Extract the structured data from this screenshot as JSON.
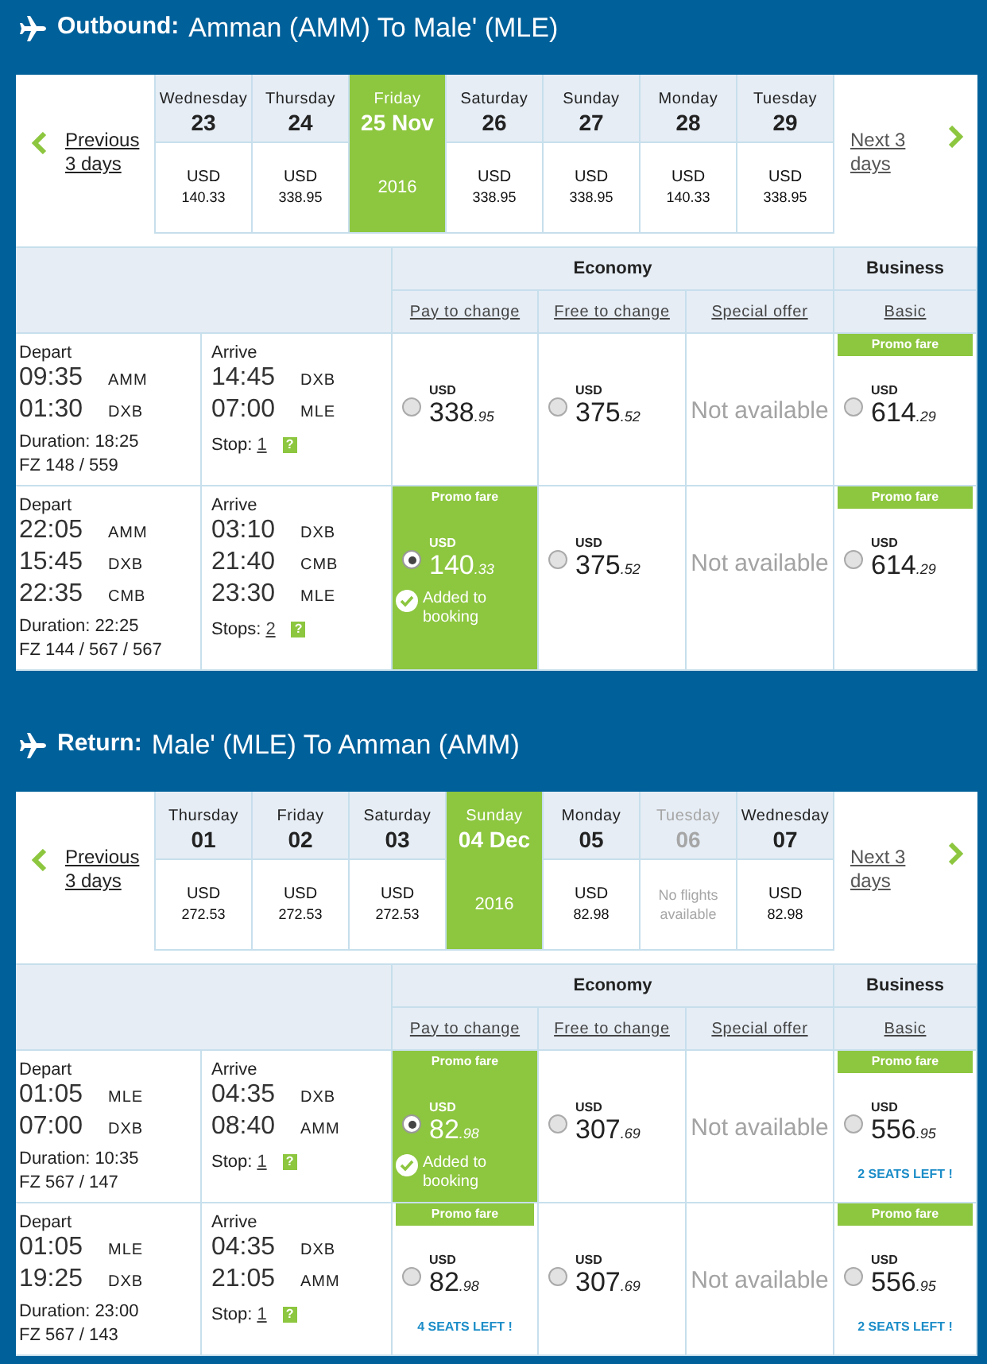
{
  "sections": [
    {
      "direction": "Outbound:",
      "route": "Amman (AMM) To Male' (MLE)",
      "previous": [
        "Previous",
        "3 days"
      ],
      "next": [
        "Next 3",
        "days"
      ],
      "dates": [
        {
          "weekday": "Wednesday",
          "day": "23",
          "selected": false,
          "disabled": false,
          "currency": "USD",
          "price": "140.33"
        },
        {
          "weekday": "Thursday",
          "day": "24",
          "selected": false,
          "disabled": false,
          "currency": "USD",
          "price": "338.95"
        },
        {
          "weekday": "Friday",
          "day": "25 Nov",
          "selected": true,
          "disabled": false,
          "year": "2016"
        },
        {
          "weekday": "Saturday",
          "day": "26",
          "selected": false,
          "disabled": false,
          "currency": "USD",
          "price": "338.95"
        },
        {
          "weekday": "Sunday",
          "day": "27",
          "selected": false,
          "disabled": false,
          "currency": "USD",
          "price": "338.95"
        },
        {
          "weekday": "Monday",
          "day": "28",
          "selected": false,
          "disabled": false,
          "currency": "USD",
          "price": "140.33"
        },
        {
          "weekday": "Tuesday",
          "day": "29",
          "selected": false,
          "disabled": false,
          "currency": "USD",
          "price": "338.95"
        }
      ],
      "cabins": [
        {
          "name": "Economy",
          "fares": [
            "Pay to change",
            "Free to change",
            "Special offer"
          ]
        },
        {
          "name": "Business",
          "fares": [
            "Basic"
          ]
        }
      ],
      "flights": [
        {
          "depart": {
            "label": "Depart",
            "legs": [
              {
                "time": "09:35",
                "code": "AMM"
              },
              {
                "time": "01:30",
                "code": "DXB"
              }
            ],
            "duration": "Duration: 18:25",
            "flight_numbers": "FZ 148 / 559"
          },
          "arrive": {
            "label": "Arrive",
            "legs": [
              {
                "time": "14:45",
                "code": "DXB"
              },
              {
                "time": "07:00",
                "code": "MLE"
              }
            ],
            "stops_label": "Stop:",
            "stops": "1",
            "help": "?"
          },
          "fares": [
            {
              "kind": "fare",
              "selected": false,
              "currency": "USD",
              "amount": "338",
              "cents": ".95"
            },
            {
              "kind": "fare",
              "selected": false,
              "currency": "USD",
              "amount": "375",
              "cents": ".52"
            },
            {
              "kind": "unavailable",
              "text": "Not available"
            },
            {
              "kind": "fare",
              "selected": false,
              "badge": "Promo fare",
              "currency": "USD",
              "amount": "614",
              "cents": ".29"
            }
          ]
        },
        {
          "depart": {
            "label": "Depart",
            "legs": [
              {
                "time": "22:05",
                "code": "AMM"
              },
              {
                "time": "15:45",
                "code": "DXB"
              },
              {
                "time": "22:35",
                "code": "CMB"
              }
            ],
            "duration": "Duration: 22:25",
            "flight_numbers": "FZ 144 / 567 / 567"
          },
          "arrive": {
            "label": "Arrive",
            "legs": [
              {
                "time": "03:10",
                "code": "DXB"
              },
              {
                "time": "21:40",
                "code": "CMB"
              },
              {
                "time": "23:30",
                "code": "MLE"
              }
            ],
            "stops_label": "Stops:",
            "stops": "2",
            "help": "?"
          },
          "fares": [
            {
              "kind": "fare",
              "selected": true,
              "badge": "Promo fare",
              "currency": "USD",
              "amount": "140",
              "cents": ".33",
              "added": "Added to booking"
            },
            {
              "kind": "fare",
              "selected": false,
              "currency": "USD",
              "amount": "375",
              "cents": ".52"
            },
            {
              "kind": "unavailable",
              "text": "Not available"
            },
            {
              "kind": "fare",
              "selected": false,
              "badge": "Promo fare",
              "currency": "USD",
              "amount": "614",
              "cents": ".29"
            }
          ]
        }
      ]
    },
    {
      "direction": "Return:",
      "route": "Male' (MLE) To Amman (AMM)",
      "previous": [
        "Previous",
        "3 days"
      ],
      "next": [
        "Next 3",
        "days"
      ],
      "dates": [
        {
          "weekday": "Thursday",
          "day": "01",
          "selected": false,
          "disabled": false,
          "currency": "USD",
          "price": "272.53"
        },
        {
          "weekday": "Friday",
          "day": "02",
          "selected": false,
          "disabled": false,
          "currency": "USD",
          "price": "272.53"
        },
        {
          "weekday": "Saturday",
          "day": "03",
          "selected": false,
          "disabled": false,
          "currency": "USD",
          "price": "272.53"
        },
        {
          "weekday": "Sunday",
          "day": "04 Dec",
          "selected": true,
          "disabled": false,
          "year": "2016"
        },
        {
          "weekday": "Monday",
          "day": "05",
          "selected": false,
          "disabled": false,
          "currency": "USD",
          "price": "82.98"
        },
        {
          "weekday": "Tuesday",
          "day": "06",
          "selected": false,
          "disabled": true,
          "note": "No flights available"
        },
        {
          "weekday": "Wednesday",
          "day": "07",
          "selected": false,
          "disabled": false,
          "currency": "USD",
          "price": "82.98"
        }
      ],
      "cabins": [
        {
          "name": "Economy",
          "fares": [
            "Pay to change",
            "Free to change",
            "Special offer"
          ]
        },
        {
          "name": "Business",
          "fares": [
            "Basic"
          ]
        }
      ],
      "flights": [
        {
          "depart": {
            "label": "Depart",
            "legs": [
              {
                "time": "01:05",
                "code": "MLE"
              },
              {
                "time": "07:00",
                "code": "DXB"
              }
            ],
            "duration": "Duration: 10:35",
            "flight_numbers": "FZ 567 / 147"
          },
          "arrive": {
            "label": "Arrive",
            "legs": [
              {
                "time": "04:35",
                "code": "DXB"
              },
              {
                "time": "08:40",
                "code": "AMM"
              }
            ],
            "stops_label": "Stop:",
            "stops": "1",
            "help": "?"
          },
          "fares": [
            {
              "kind": "fare",
              "selected": true,
              "badge": "Promo fare",
              "currency": "USD",
              "amount": "82",
              "cents": ".98",
              "added": "Added to booking"
            },
            {
              "kind": "fare",
              "selected": false,
              "currency": "USD",
              "amount": "307",
              "cents": ".69"
            },
            {
              "kind": "unavailable",
              "text": "Not available"
            },
            {
              "kind": "fare",
              "selected": false,
              "badge": "Promo fare",
              "currency": "USD",
              "amount": "556",
              "cents": ".95",
              "seats": "2 SEATS LEFT !"
            }
          ]
        },
        {
          "depart": {
            "label": "Depart",
            "legs": [
              {
                "time": "01:05",
                "code": "MLE"
              },
              {
                "time": "19:25",
                "code": "DXB"
              }
            ],
            "duration": "Duration: 23:00",
            "flight_numbers": "FZ 567 / 143"
          },
          "arrive": {
            "label": "Arrive",
            "legs": [
              {
                "time": "04:35",
                "code": "DXB"
              },
              {
                "time": "21:05",
                "code": "AMM"
              }
            ],
            "stops_label": "Stop:",
            "stops": "1",
            "help": "?"
          },
          "fares": [
            {
              "kind": "fare",
              "selected": false,
              "badge": "Promo fare",
              "currency": "USD",
              "amount": "82",
              "cents": ".98",
              "seats": "4 SEATS LEFT !"
            },
            {
              "kind": "fare",
              "selected": false,
              "currency": "USD",
              "amount": "307",
              "cents": ".69"
            },
            {
              "kind": "unavailable",
              "text": "Not available"
            },
            {
              "kind": "fare",
              "selected": false,
              "badge": "Promo fare",
              "currency": "USD",
              "amount": "556",
              "cents": ".95",
              "seats": "2 SEATS LEFT !"
            }
          ]
        }
      ]
    }
  ]
}
